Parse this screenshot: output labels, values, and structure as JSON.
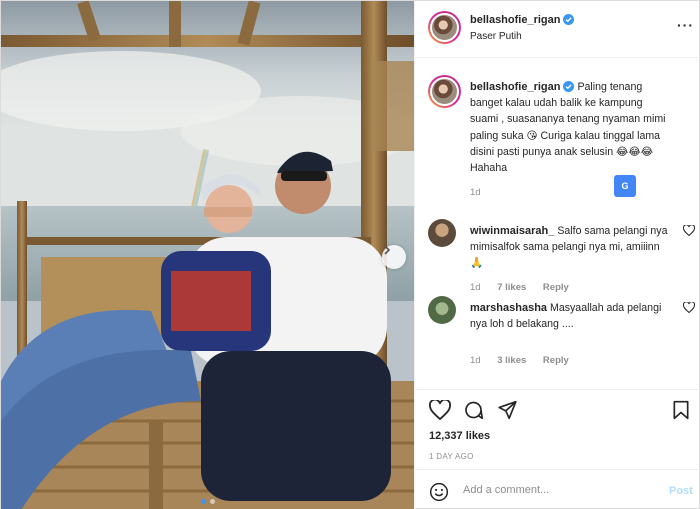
{
  "post": {
    "username": "bellashofie_rigan",
    "location": "Paser Putih",
    "caption": "Paling tenang banget kalau udah balik ke kampung suami , suasananya tenang nyaman mimi paling suka 😘 Curiga kalau tinggal lama disini pasti punya anak selusin 😂😂😂 Hahaha",
    "caption_time": "1d",
    "translate_label": "G",
    "likes": "12,337 likes",
    "posted": "1 DAY AGO",
    "more_icon": "···"
  },
  "comments": [
    {
      "username": "wiwinmaisarah_",
      "text": "Salfo sama pelangi nya mimisalfok sama pelangi nya mi, amiiinn 🙏",
      "time": "1d",
      "likes": "7 likes",
      "reply": "Reply"
    },
    {
      "username": "marshashasha",
      "text": "Masyaallah ada pelangi nya loh d belakang ....",
      "time": "1d",
      "likes": "3 likes",
      "reply": "Reply"
    }
  ],
  "add_comment": {
    "placeholder": "Add a comment...",
    "post_label": "Post"
  },
  "colors": {
    "accent": "#3897f0",
    "verified": "#3897f0",
    "post_disabled": "#b2dffc"
  },
  "icons": [
    "heart-icon",
    "comment-icon",
    "share-icon",
    "bookmark-icon",
    "emoji-icon",
    "verified-icon",
    "chevron-right-icon"
  ]
}
